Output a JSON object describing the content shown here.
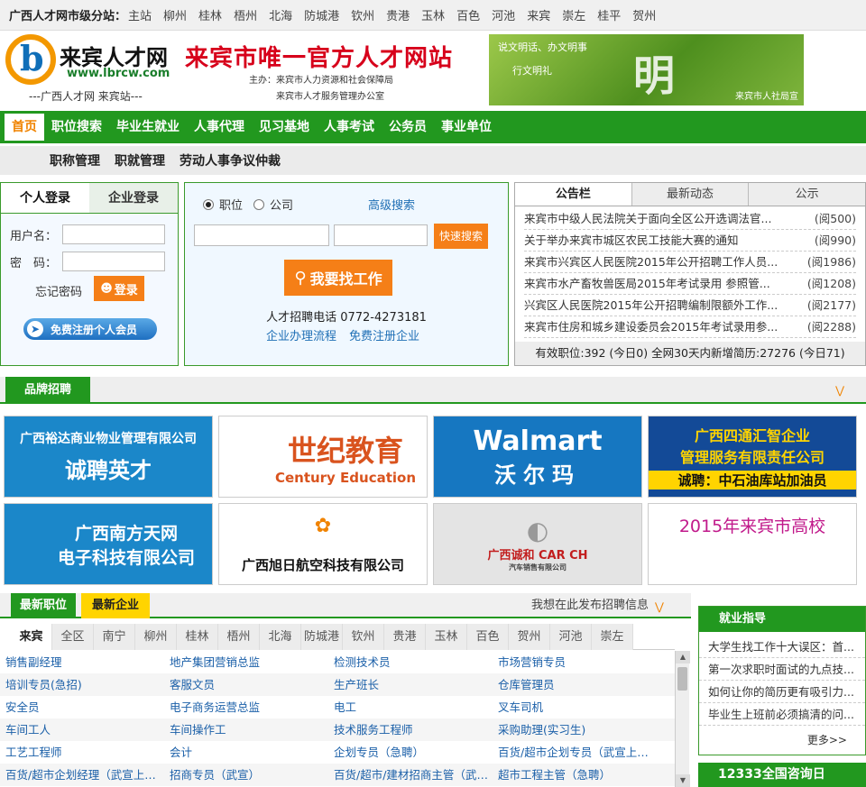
{
  "citybar": {
    "label": "广西人才网市级分站：",
    "cities": [
      "主站",
      "柳州",
      "桂林",
      "梧州",
      "北海",
      "防城港",
      "钦州",
      "贵港",
      "玉林",
      "百色",
      "河池",
      "来宾",
      "崇左",
      "桂平",
      "贺州"
    ]
  },
  "header": {
    "logo_letter": "b",
    "logo_name": "来宾人才网",
    "logo_url": "www.lbrcw.com",
    "logo_sub": "---广西人才网 来宾站---",
    "slogan": "来宾市唯一官方人才网站",
    "host1": "主办：来宾市人力资源和社会保障局",
    "host2": "来宾市人才服务管理办公室",
    "banner_line1": "说文明话、办文明事",
    "banner_line2": "行文明礼",
    "banner_big": "明",
    "banner_credit": "来宾市人社局宣"
  },
  "nav1": [
    "首页",
    "职位搜索",
    "毕业生就业",
    "人事代理",
    "见习基地",
    "人事考试",
    "公务员",
    "事业单位"
  ],
  "nav2": [
    "职称管理",
    "职就管理",
    "劳动人事争议仲裁"
  ],
  "login": {
    "tab_personal": "个人登录",
    "tab_company": "企业登录",
    "username_label": "用户名：",
    "password_label": "密　码：",
    "forgot": "忘记密码",
    "login_btn": "登录",
    "register": "免费注册个人会员"
  },
  "search": {
    "opt_job": "职位",
    "opt_company": "公司",
    "advanced": "高级搜索",
    "quick": "快速搜索",
    "find": "我要找工作",
    "phone": "人才招聘电话 0772-4273181",
    "link1": "企业办理流程",
    "link2": "免费注册企业"
  },
  "notice": {
    "tabs": [
      "公告栏",
      "最新动态",
      "公示"
    ],
    "items": [
      {
        "title": "来宾市中级人民法院关于面向全区公开选调法官...",
        "reads": "(阅500)"
      },
      {
        "title": "关于举办来宾市城区农民工技能大赛的通知",
        "reads": "(阅990)"
      },
      {
        "title": "来宾市兴宾区人民医院2015年公开招聘工作人员...",
        "reads": "(阅1986)"
      },
      {
        "title": "来宾市水产畜牧兽医局2015年考试录用 参照管...",
        "reads": "(阅1208)"
      },
      {
        "title": "兴宾区人民医院2015年公开招聘编制限额外工作...",
        "reads": "(阅2177)"
      },
      {
        "title": "来宾市住房和城乡建设委员会2015年考试录用参...",
        "reads": "(阅2288)"
      }
    ],
    "stat": "有效职位:392 (今日0) 全网30天内新增简历:27276 (今日71)"
  },
  "brand": {
    "title": "品牌招聘",
    "logos": [
      {
        "l1": "广西裕达商业物业管理有限公司",
        "l2": "诚聘英才"
      },
      {
        "l1": "世纪教育",
        "l2": "Century Education"
      },
      {
        "l1": "Walmart",
        "l2": "沃尔玛"
      },
      {
        "l1": "广西四通汇智企业",
        "l2": "管理服务有限责任公司",
        "l3": "诚聘：中石油库站加油员"
      },
      {
        "l1": "广西南方天网",
        "l2": "电子科技有限公司"
      },
      {
        "l1": "广西旭日航空科技有限公司"
      },
      {
        "l1": "广西诚和 CAR CH",
        "l2": "汽车销售有限公司"
      },
      {
        "l1": "2015年来宾市高校"
      }
    ]
  },
  "jobs": {
    "tab_jobs": "最新职位",
    "tab_companies": "最新企业",
    "publish": "我想在此发布招聘信息",
    "cities": [
      "来宾",
      "全区",
      "南宁",
      "柳州",
      "桂林",
      "梧州",
      "北海",
      "防城港",
      "钦州",
      "贵港",
      "玉林",
      "百色",
      "贺州",
      "河池",
      "崇左"
    ],
    "rows": [
      [
        "销售副经理",
        "地产集团营销总监",
        "检测技术员",
        "市场营销专员"
      ],
      [
        "培训专员(急招)",
        "客服文员",
        "生产班长",
        "仓库管理员"
      ],
      [
        "安全员",
        "电子商务运营总监",
        "电工",
        "叉车司机"
      ],
      [
        "车间工人",
        "车间操作工",
        "技术服务工程师",
        "采购助理(实习生)"
      ],
      [
        "工艺工程师",
        "会计",
        "企划专员（急聘）",
        "百货/超市企划专员（武宣上班）"
      ],
      [
        "百货/超市企划经理（武宣上班）",
        "招商专员（武宣）",
        "百货/超市/建材招商主管（武宣上班）",
        "超市工程主管（急聘）"
      ]
    ]
  },
  "guide": {
    "title": "就业指导",
    "items": [
      "大学生找工作十大误区：首...",
      "第一次求职时面试的九点技...",
      "如何让你的简历更有吸引力...",
      "毕业生上班前必须搞清的问..."
    ],
    "more": "更多>>"
  },
  "consult": "12333全国咨询日",
  "colors": {
    "green": "#22981f",
    "orange": "#f57f17",
    "red": "#d7001b",
    "link": "#1a5fa8"
  }
}
